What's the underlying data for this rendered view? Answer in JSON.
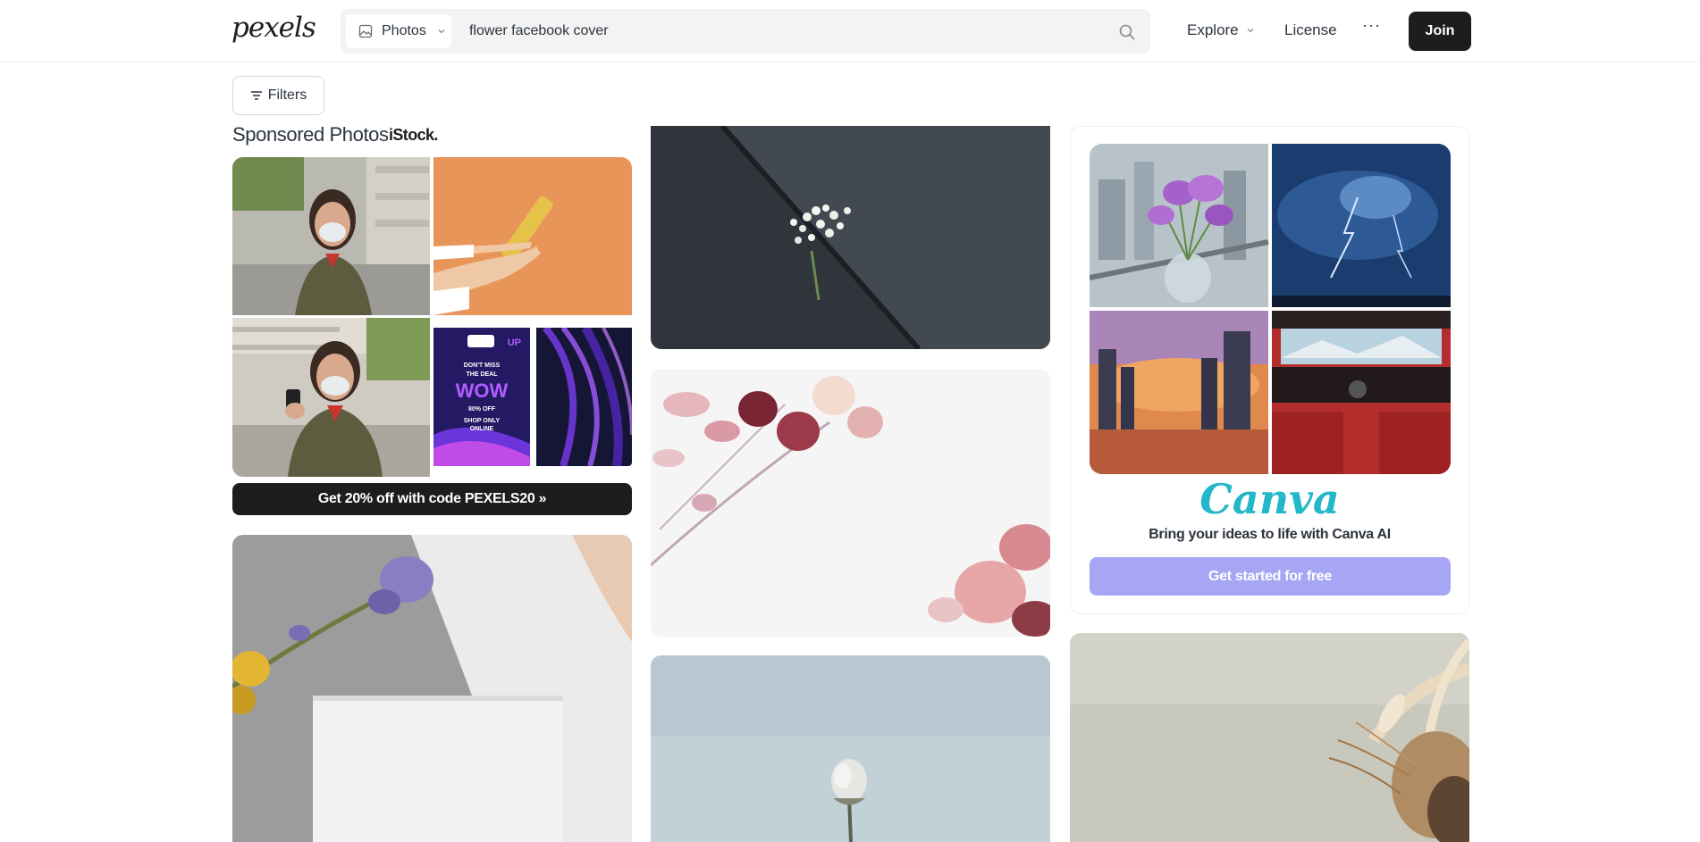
{
  "header": {
    "logo_text": "pexels",
    "search_type": "Photos",
    "search_value": "flower facebook cover",
    "nav_explore": "Explore",
    "nav_license": "License",
    "nav_more": "···",
    "join_label": "Join"
  },
  "filters": {
    "label": "Filters"
  },
  "sponsored": {
    "title": "Sponsored Photos",
    "brand": "iStock.",
    "promo_label": "Get 20% off with code PEXELS20 »",
    "poster_text": {
      "line1": "DON'T MISS",
      "line2": "THE DEAL",
      "line3": "WOW",
      "line4": "80% OFF",
      "line5": "SHOP ONLY",
      "line6": "ONLINE",
      "hurry": "UP"
    }
  },
  "canva": {
    "logo": "Canva",
    "tagline": "Bring your ideas to life with Canva AI",
    "cta_label": "Get started for free"
  },
  "colors": {
    "accent_dark": "#1d1d1d",
    "canva_teal": "#22b7c9",
    "canva_purple": "#a6a6f5",
    "search_bg": "#f3f3f3"
  }
}
